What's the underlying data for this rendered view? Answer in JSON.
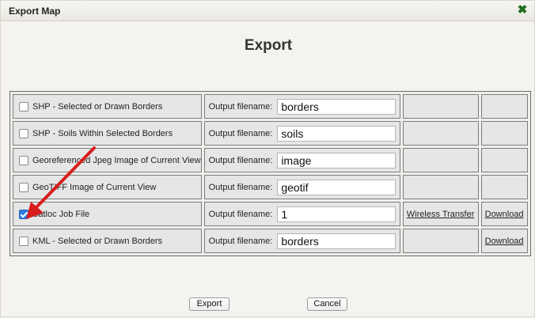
{
  "dialog": {
    "title": "Export Map",
    "close_icon": "close-x-icon",
    "heading": "Export"
  },
  "table": {
    "filename_label": "Output filename:",
    "rows": [
      {
        "option": "SHP - Selected or Drawn Borders",
        "checked": false,
        "filename": "borders",
        "wireless": "",
        "download": ""
      },
      {
        "option": "SHP - Soils Within Selected Borders",
        "checked": false,
        "filename": "soils",
        "wireless": "",
        "download": ""
      },
      {
        "option": "Georeferenced Jpeg Image of Current View",
        "checked": false,
        "filename": "image",
        "wireless": "",
        "download": ""
      },
      {
        "option": "GeoTIFF Image of Current View",
        "checked": false,
        "filename": "geotif",
        "wireless": "",
        "download": ""
      },
      {
        "option": "Satloc Job File",
        "checked": true,
        "filename": "1",
        "wireless": "Wireless Transfer",
        "download": "Download"
      },
      {
        "option": "KML - Selected or Drawn Borders",
        "checked": false,
        "filename": "borders",
        "wireless": "",
        "download": "Download"
      }
    ]
  },
  "buttons": {
    "export": "Export",
    "cancel": "Cancel"
  },
  "colors": {
    "arrow": "#d81d1d",
    "checkbox_checked": "#2f7ce0",
    "close_icon": "#1e6b1e"
  }
}
